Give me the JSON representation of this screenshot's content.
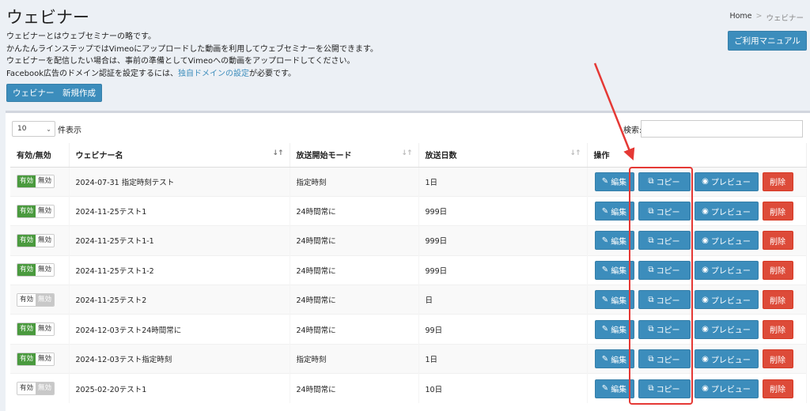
{
  "header": {
    "title": "ウェビナー",
    "breadcrumb": {
      "home": "Home",
      "separator": ">",
      "current": "ウェビナー"
    }
  },
  "description": {
    "line1": "ウェビナーとはウェブセミナーの略です。",
    "line2": "かんたんラインステップではVimeoにアップロードした動画を利用してウェブセミナーを公開できます。",
    "line3": "ウェビナーを配信したい場合は、事前の準備としてVimeoへの動画をアップロードしてください。",
    "line4_prefix": "Facebook広告のドメイン認証を設定するには、",
    "line4_link": "独自ドメインの設定",
    "line4_suffix": "が必要です。"
  },
  "buttons": {
    "manual": "ご利用マニュアル",
    "create": "ウェビナー　新規作成"
  },
  "table_controls": {
    "page_length": "10",
    "page_length_label": "件表示",
    "search_label": "検索:",
    "search_value": ""
  },
  "columns": {
    "status": "有効/無効",
    "name": "ウェビナー名",
    "mode": "放送開始モード",
    "days": "放送日数",
    "actions": "操作"
  },
  "toggle_labels": {
    "on": "有効",
    "off": "無効"
  },
  "action_labels": {
    "edit": "編集",
    "copy": "コピー",
    "preview": "プレビュー",
    "delete": "削除"
  },
  "rows": [
    {
      "enabled": true,
      "name": "2024-07-31 指定時刻テスト",
      "mode": "指定時刻",
      "days": "1日"
    },
    {
      "enabled": true,
      "name": "2024-11-25テスト1",
      "mode": "24時間常に",
      "days": "999日"
    },
    {
      "enabled": true,
      "name": "2024-11-25テスト1-1",
      "mode": "24時間常に",
      "days": "999日"
    },
    {
      "enabled": true,
      "name": "2024-11-25テスト1-2",
      "mode": "24時間常に",
      "days": "999日"
    },
    {
      "enabled": false,
      "name": "2024-11-25テスト2",
      "mode": "24時間常に",
      "days": "日"
    },
    {
      "enabled": true,
      "name": "2024-12-03テスト24時間常に",
      "mode": "24時間常に",
      "days": "99日"
    },
    {
      "enabled": true,
      "name": "2024-12-03テスト指定時刻",
      "mode": "指定時刻",
      "days": "1日"
    },
    {
      "enabled": false,
      "name": "2025-02-20テスト1",
      "mode": "24時間常に",
      "days": "10日"
    }
  ],
  "annotation": {
    "color": "#e53935",
    "target": "copy-button-column"
  },
  "colors": {
    "primary": "#3c8dbc",
    "danger": "#dd4b39",
    "success": "#4a9a3e"
  }
}
